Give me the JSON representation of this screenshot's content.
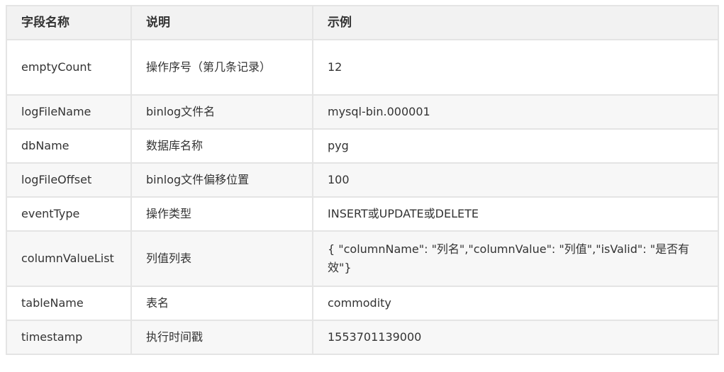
{
  "headers": [
    "字段名称",
    "说明",
    "示例"
  ],
  "rows": [
    {
      "field": "emptyCount",
      "desc": "操作序号（第几条记录）",
      "example": "12"
    },
    {
      "field": "logFileName",
      "desc": "binlog文件名",
      "example": "mysql-bin.000001"
    },
    {
      "field": "dbName",
      "desc": "数据库名称",
      "example": "pyg"
    },
    {
      "field": "logFileOffset",
      "desc": "binlog文件偏移位置",
      "example": "100"
    },
    {
      "field": "eventType",
      "desc": "操作类型",
      "example": "INSERT或UPDATE或DELETE"
    },
    {
      "field": "columnValueList",
      "desc": "列值列表",
      "example": "{ \"columnName\": \"列名\",\"columnValue\": \"列值\",\"isValid\": \"是否有效\"}"
    },
    {
      "field": "tableName",
      "desc": "表名",
      "example": "commodity"
    },
    {
      "field": "timestamp",
      "desc": "执行时间戳",
      "example": "1553701139000"
    }
  ]
}
